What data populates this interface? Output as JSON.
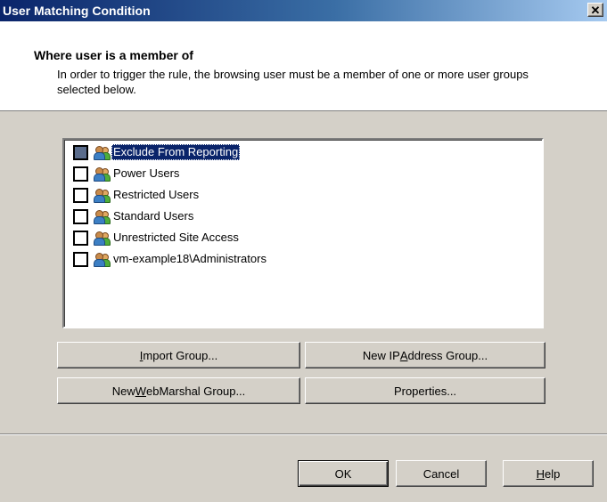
{
  "window": {
    "title": "User Matching Condition",
    "close_glyph": "✕"
  },
  "header": {
    "heading": "Where user is a member of",
    "description": "In order to trigger the rule, the browsing user must be a member of one or more user groups selected below."
  },
  "groups": [
    {
      "label": "Exclude From Reporting",
      "checked": false,
      "selected": true,
      "icon": "user-group-icon"
    },
    {
      "label": "Power Users",
      "checked": false,
      "selected": false,
      "icon": "user-group-icon"
    },
    {
      "label": "Restricted Users",
      "checked": false,
      "selected": false,
      "icon": "user-group-icon"
    },
    {
      "label": "Standard Users",
      "checked": false,
      "selected": false,
      "icon": "user-group-icon"
    },
    {
      "label": "Unrestricted Site Access",
      "checked": false,
      "selected": false,
      "icon": "user-group-icon"
    },
    {
      "label": "vm-example18\\Administrators",
      "checked": false,
      "selected": false,
      "icon": "user-group-icon"
    }
  ],
  "actions": {
    "import_pre": "",
    "import_key": "I",
    "import_post": "mport Group...",
    "new_ip_pre": "New IP ",
    "new_ip_key": "A",
    "new_ip_post": "ddress Group...",
    "new_wm_pre": "New ",
    "new_wm_key": "W",
    "new_wm_post": "ebMarshal Group...",
    "properties": "Properties..."
  },
  "footer": {
    "ok": "OK",
    "cancel": "Cancel",
    "help_key": "H",
    "help_post": "elp"
  }
}
